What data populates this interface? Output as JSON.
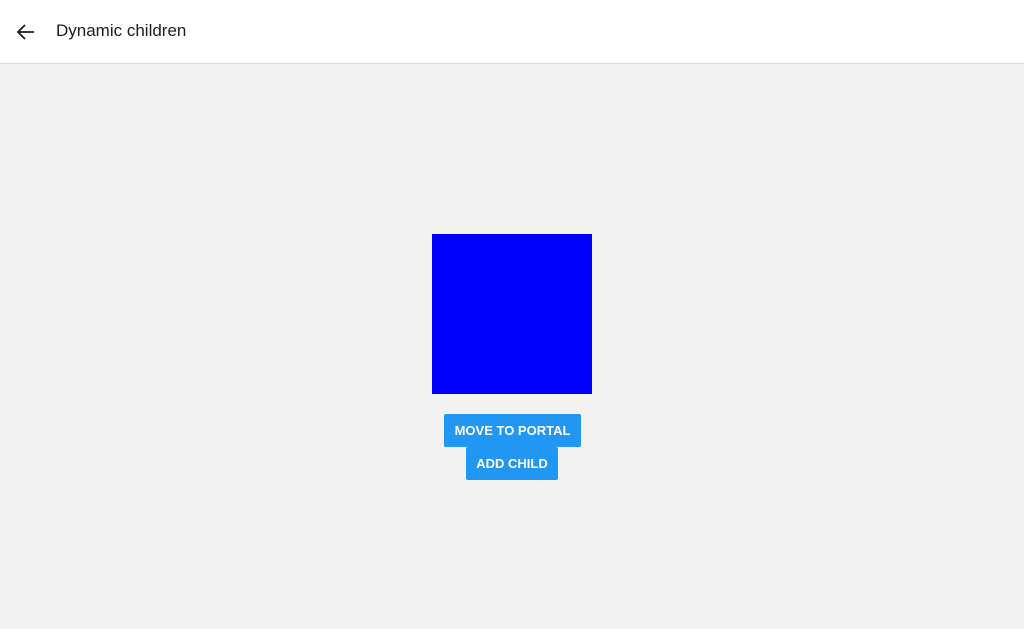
{
  "header": {
    "title": "Dynamic children",
    "back_icon": "arrow-left-icon"
  },
  "main": {
    "box_color": "#0000ff",
    "buttons": {
      "move_to_portal": "MOVE TO PORTAL",
      "add_child": "ADD CHILD"
    }
  }
}
